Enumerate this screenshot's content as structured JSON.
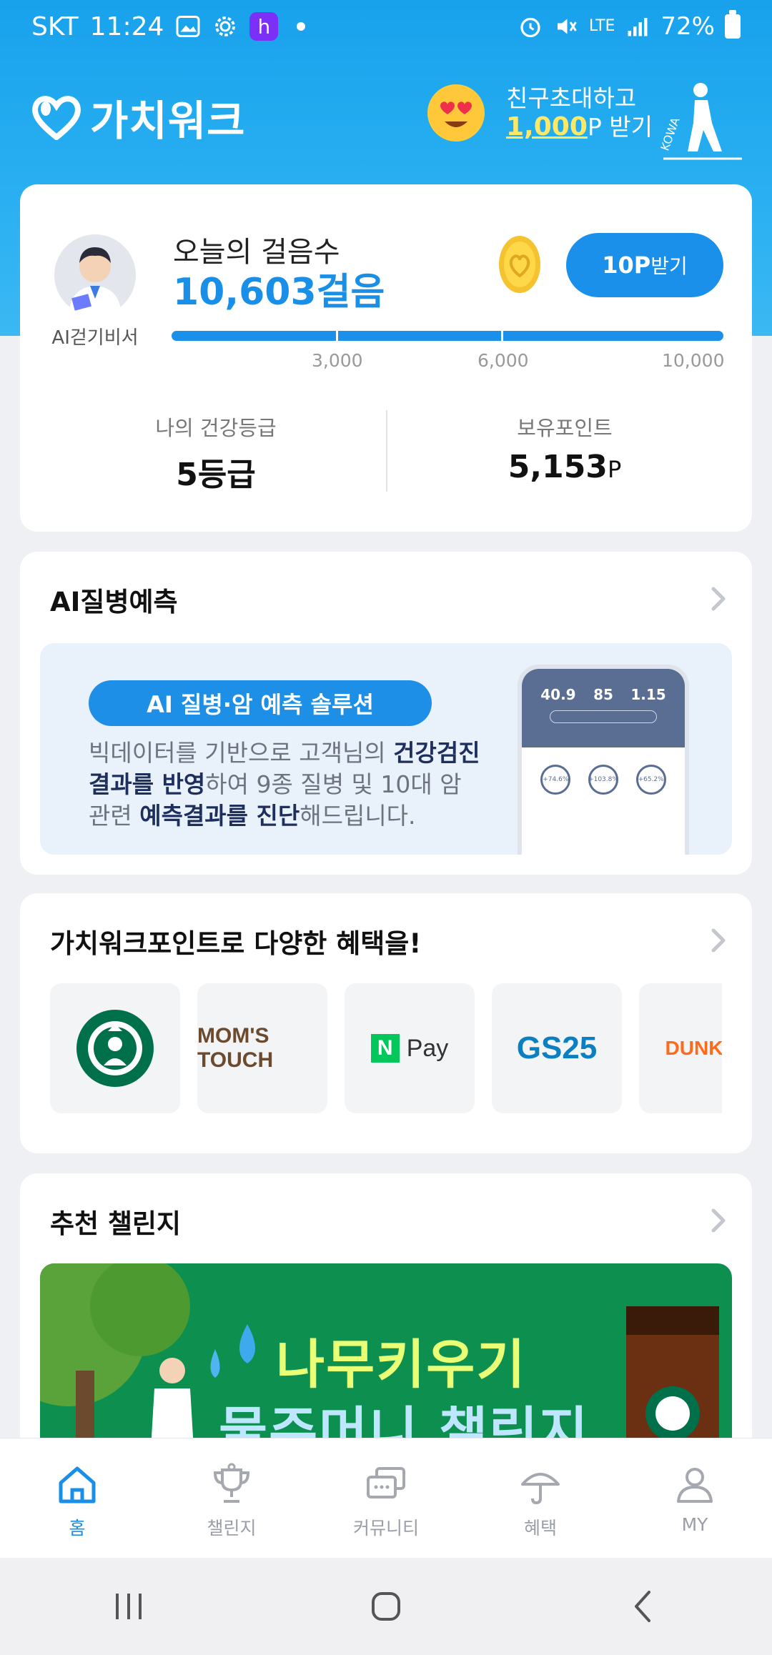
{
  "status_bar": {
    "carrier": "SKT",
    "time": "11:24",
    "h_badge": "h",
    "lte": "LTE",
    "battery": "72%"
  },
  "header": {
    "app_name": "가치워크",
    "invite_line1": "친구초대하고",
    "invite_amount": "1,000",
    "invite_suffix": "P 받기"
  },
  "steps_card": {
    "assistant_label": "AI걷기비서",
    "steps_label": "오늘의 걸음수",
    "steps_value": "10,603걸음",
    "claim_points": "10P",
    "claim_suffix": "받기",
    "progress": 1.0,
    "ticks": [
      "3,000",
      "6,000",
      "10,000"
    ],
    "grade_label": "나의 건강등급",
    "grade_value": "5등급",
    "points_label": "보유포인트",
    "points_value": "5,153",
    "points_unit": "P"
  },
  "ai_card": {
    "title": "AI질병예측",
    "pill": "AI 질병·암 예측 솔루션",
    "desc_part1": "빅데이터를 기반으로 고객님의 ",
    "desc_bold1": "건강검진 결과를 반영",
    "desc_part2": "하여 9종 질병 및 10대 암 관련 ",
    "desc_bold2": "예측결과를 진단",
    "desc_part3": "해드립니다.",
    "phone_stats": [
      "40.9",
      "85",
      "1.15"
    ],
    "phone_rings": [
      "+74.6%",
      "+103.8%",
      "+65.2%"
    ]
  },
  "benefit_card": {
    "title": "가치워크포인트로 다양한 혜택을!",
    "brands": [
      "MOM'S TOUCH",
      "Pay",
      "GS25",
      "DUNKIN"
    ]
  },
  "challenge_card": {
    "title": "추천 챌린지",
    "banner_line1": "나무키우기",
    "banner_line2": "물주머니 챌린지"
  },
  "bottom_nav": {
    "items": [
      {
        "label": "홈"
      },
      {
        "label": "챌린지"
      },
      {
        "label": "커뮤니티"
      },
      {
        "label": "혜택"
      },
      {
        "label": "MY"
      }
    ]
  },
  "colors": {
    "primary": "#1a90ea",
    "header_bg": "#18a2ec",
    "page_bg": "#eef0f4"
  }
}
